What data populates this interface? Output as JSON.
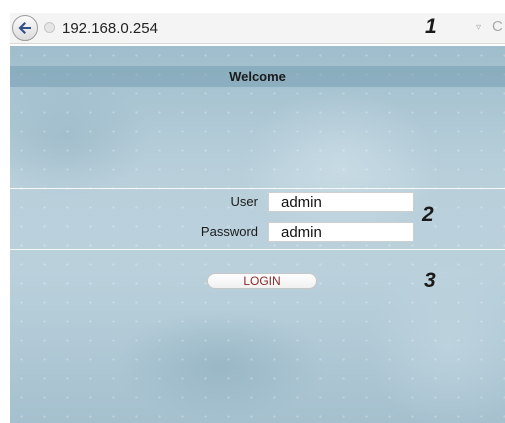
{
  "browser": {
    "url": "192.168.0.254",
    "back_icon": "back-arrow-icon",
    "site_icon": "site-info-icon",
    "dropdown_glyph": "▿",
    "reload_glyph": "C"
  },
  "callouts": [
    "1",
    "2",
    "3"
  ],
  "page": {
    "welcome": "Welcome",
    "user_label": "User",
    "user_value": "admin",
    "password_label": "Password",
    "password_value": "admin",
    "login_label": "LOGIN"
  },
  "colors": {
    "login_text": "#8a2a2a",
    "welcome_bar": "#769eb2"
  }
}
